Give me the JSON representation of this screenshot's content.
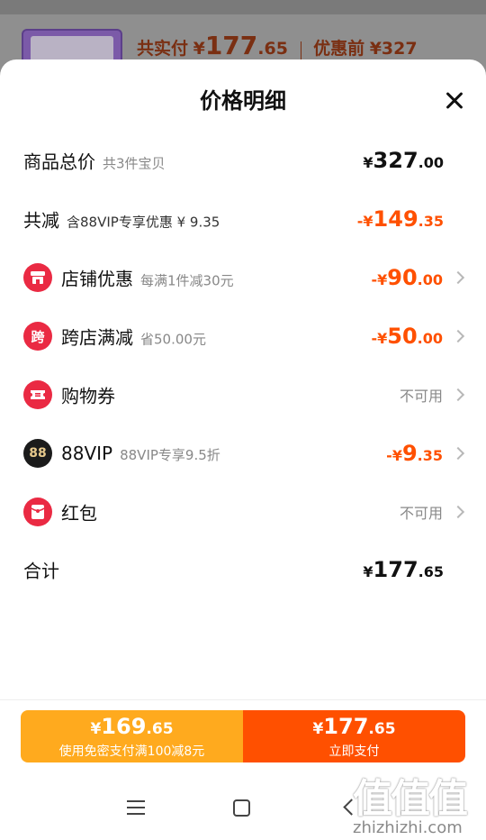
{
  "background": {
    "label_paid": "共实付",
    "currency": "¥",
    "paid_int": "177",
    "paid_dec": ".65",
    "label_before": "优惠前",
    "before_value": "¥327"
  },
  "sheet": {
    "title": "价格明细"
  },
  "rows": [
    {
      "label": "商品总价",
      "sub": "共3件宝贝",
      "value_prefix": "¥",
      "value_int": "327",
      "value_dec": ".00"
    },
    {
      "label": "共减",
      "sub": "含88VIP专享优惠 ¥ 9.35",
      "value_prefix": "-¥",
      "value_int": "149",
      "value_dec": ".35"
    },
    {
      "label": "店铺优惠",
      "sub": "每满1件减30元",
      "value_prefix": "-¥",
      "value_int": "90",
      "value_dec": ".00",
      "icon": "shop-icon"
    },
    {
      "label": "跨店满减",
      "sub": "省50.00元",
      "value_prefix": "-¥",
      "value_int": "50",
      "value_dec": ".00",
      "icon": "cross-store-icon",
      "icon_text": "跨"
    },
    {
      "label": "购物券",
      "value_text": "不可用",
      "icon": "coupon-icon"
    },
    {
      "label": "88VIP",
      "sub": "88VIP专享9.5折",
      "value_prefix": "-¥",
      "value_int": "9",
      "value_dec": ".35",
      "icon": "vip88-icon",
      "icon_text": "88"
    },
    {
      "label": "红包",
      "value_text": "不可用",
      "icon": "red-packet-icon"
    },
    {
      "label": "合计",
      "value_prefix": "¥",
      "value_int": "177",
      "value_dec": ".65"
    }
  ],
  "pay": {
    "left_currency": "¥",
    "left_int": "169",
    "left_dec": ".65",
    "left_sub": "使用免密支付满100减8元",
    "right_currency": "¥",
    "right_int": "177",
    "right_dec": ".65",
    "right_sub": "立即支付"
  },
  "watermark": {
    "chars": "值值值",
    "url": "zhizhizhi.com"
  },
  "colors": {
    "accent": "#ff5000",
    "pay_left": "#ffaa1e",
    "icon_red": "#ea2a43"
  }
}
